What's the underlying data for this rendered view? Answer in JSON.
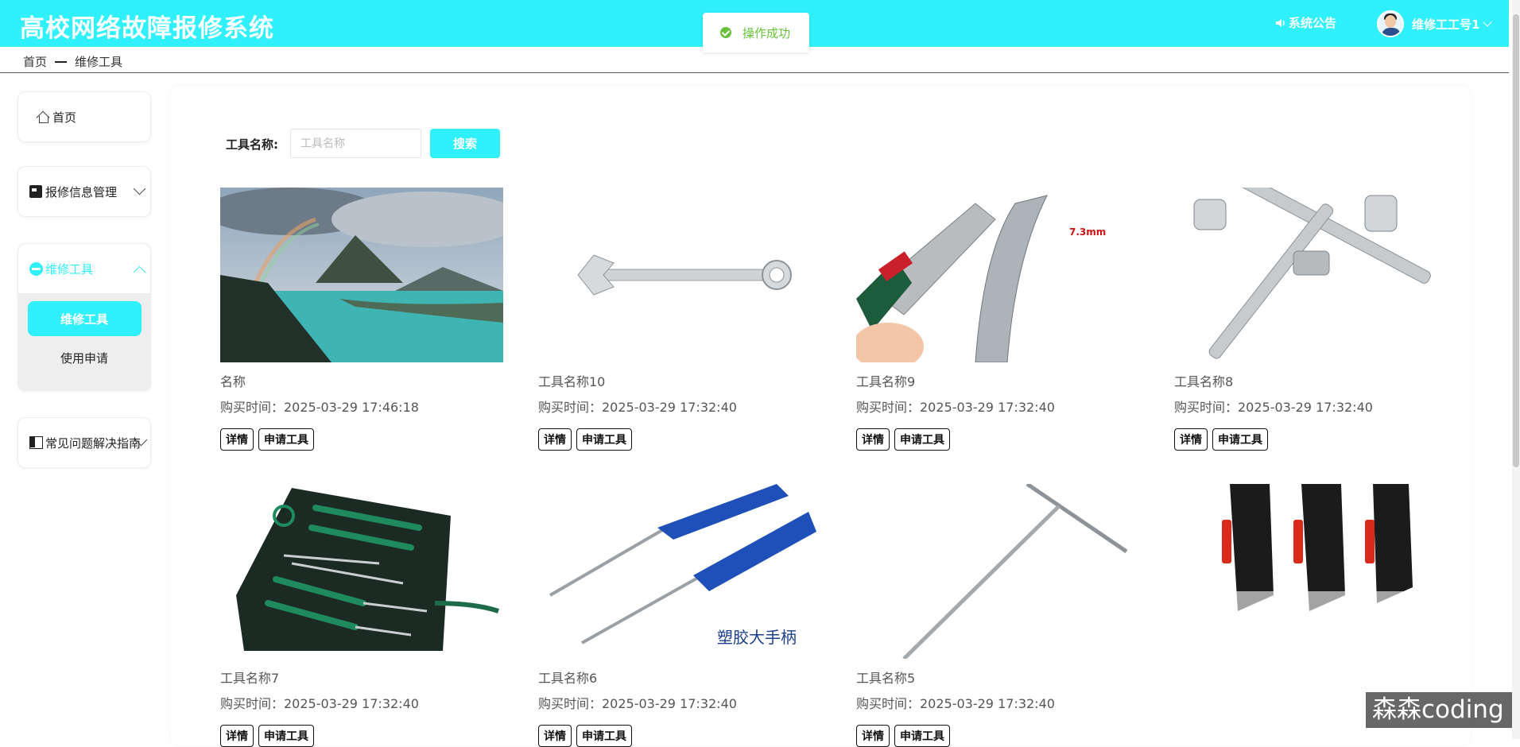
{
  "app": {
    "title": "高校网络故障报修系统"
  },
  "header": {
    "notice_label": "系统公告",
    "user_name": "维修工工号1"
  },
  "toast": {
    "message": "操作成功"
  },
  "breadcrumb": {
    "home": "首页",
    "current": "维修工具"
  },
  "sidebar": {
    "home": "首页",
    "repair_info": "报修信息管理",
    "tools_group": "维修工具",
    "sub_tools": "维修工具",
    "sub_apply": "使用申请",
    "faq": "常见问题解决指南"
  },
  "search": {
    "label": "工具名称:",
    "placeholder": "工具名称",
    "button": "搜索"
  },
  "buttons": {
    "detail": "详情",
    "apply": "申请工具"
  },
  "time_prefix": "购买时间：",
  "tools": [
    {
      "name": "名称",
      "time": "购买时间：2025-03-29 17:46:18"
    },
    {
      "name": "工具名称10",
      "time": "购买时间：2025-03-29 17:32:40"
    },
    {
      "name": "工具名称9",
      "time": "购买时间：2025-03-29 17:32:40"
    },
    {
      "name": "工具名称8",
      "time": "购买时间：2025-03-29 17:32:40"
    },
    {
      "name": "工具名称7",
      "time": "购买时间：2025-03-29 17:32:40"
    },
    {
      "name": "工具名称6",
      "time": "购买时间：2025-03-29 17:32:40"
    },
    {
      "name": "工具名称5",
      "time": "购买时间：2025-03-29 17:32:40"
    }
  ],
  "image_text": {
    "measure": "7.3mm",
    "plastic_handle": "塑胶大手柄"
  },
  "watermark": "森森coding",
  "colors": {
    "accent": "#2ff0fb",
    "success": "#67c23a"
  }
}
